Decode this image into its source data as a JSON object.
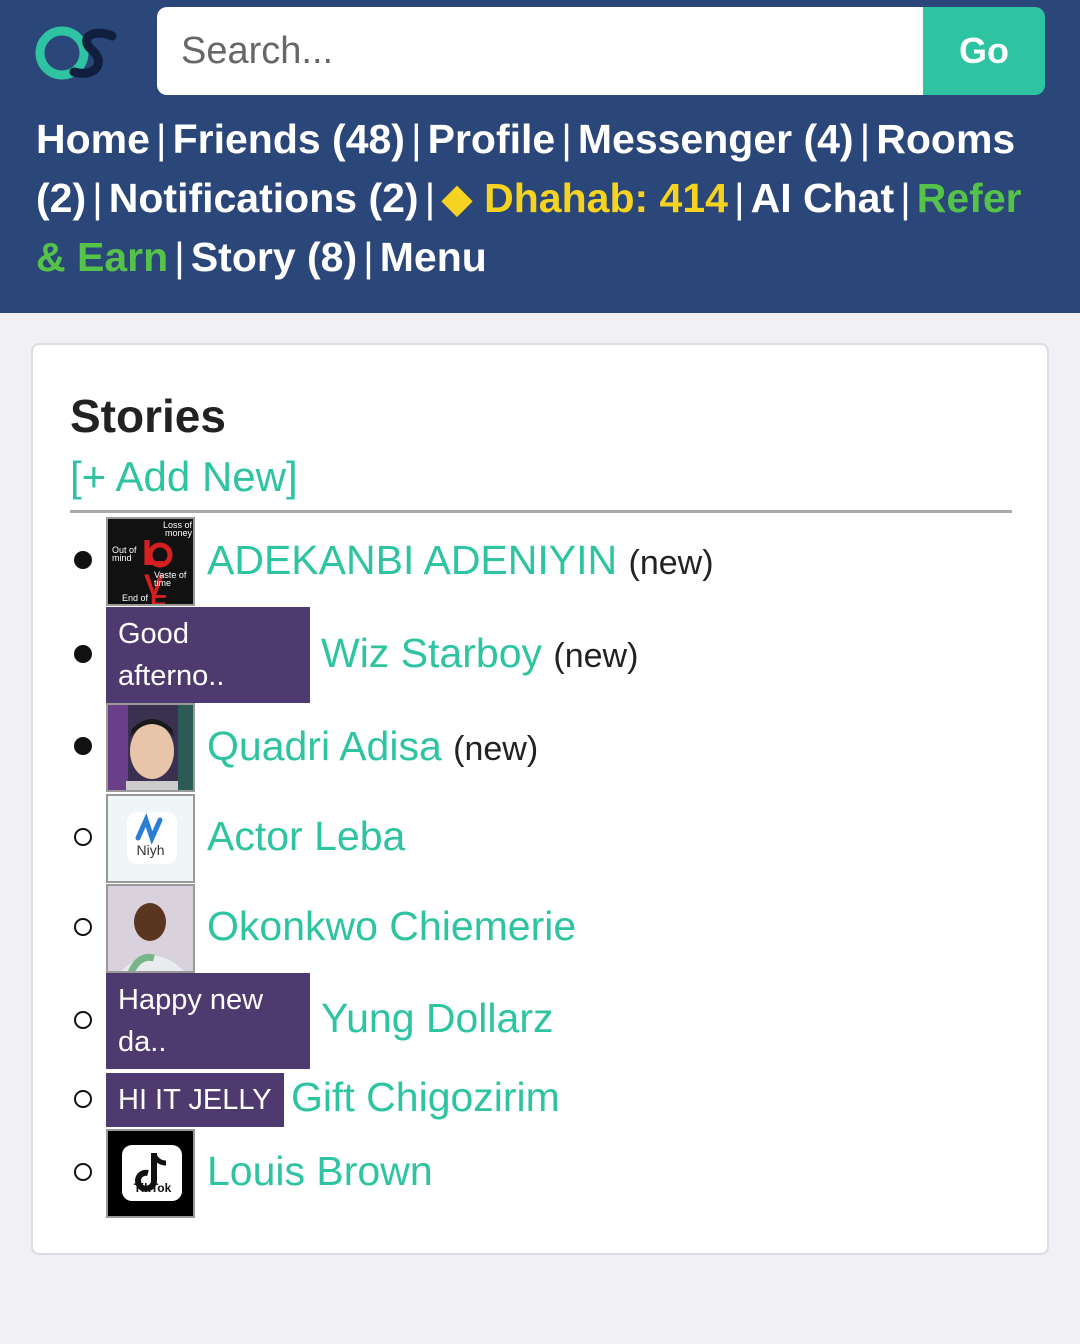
{
  "header": {
    "logo_text": "OS",
    "search": {
      "placeholder": "Search...",
      "value": ""
    },
    "go_label": "Go",
    "nav": {
      "home": "Home",
      "friends": "Friends (48)",
      "profile": "Profile",
      "messenger": "Messenger (4)",
      "rooms": "Rooms (2)",
      "notifications": "Notifications (2)",
      "dhahab": "◆ Dhahab: 414",
      "ai_chat": "AI Chat",
      "refer": "Refer & Earn",
      "story": "Story (8)",
      "menu": "Menu",
      "separator": "|"
    }
  },
  "stories": {
    "title": "Stories",
    "add_new": "[+ Add New]",
    "items": [
      {
        "name": "ADEKANBI ADENIYIN",
        "tag": "(new)",
        "seen": false,
        "thumb": "image",
        "thumb_icon": "love-poster-image",
        "thumb_lines": [
          "Loss of money",
          "Out of mind",
          "Vaste of time",
          "End of"
        ]
      },
      {
        "name": "Wiz Starboy",
        "tag": "(new)",
        "seen": false,
        "thumb": "text",
        "thumb_text": "Good afterno.."
      },
      {
        "name": "Quadri Adisa",
        "tag": "(new)",
        "seen": false,
        "thumb": "image",
        "thumb_icon": "man-portrait-image"
      },
      {
        "name": "Actor Leba",
        "tag": "",
        "seen": true,
        "thumb": "image",
        "thumb_icon": "niyh-app-logo",
        "thumb_label": "Niyh"
      },
      {
        "name": "Okonkwo Chiemerie",
        "tag": "",
        "seen": true,
        "thumb": "image",
        "thumb_icon": "selfie-photo-image"
      },
      {
        "name": "Yung Dollarz",
        "tag": "",
        "seen": true,
        "thumb": "text",
        "thumb_text": "Happy new da.."
      },
      {
        "name": "Gift Chigozirim",
        "tag": "",
        "seen": true,
        "thumb": "text",
        "thumb_text": "HI IT JELLY"
      },
      {
        "name": "Louis Brown",
        "tag": "",
        "seen": true,
        "thumb": "image",
        "thumb_icon": "tiktok-logo",
        "thumb_label": "TikTok"
      }
    ]
  },
  "colors": {
    "header_bg": "#2b4678",
    "accent": "#2ec4a2",
    "gold": "#f5d320",
    "green": "#55c24a",
    "text_thumb_bg": "#4e3a6e"
  }
}
